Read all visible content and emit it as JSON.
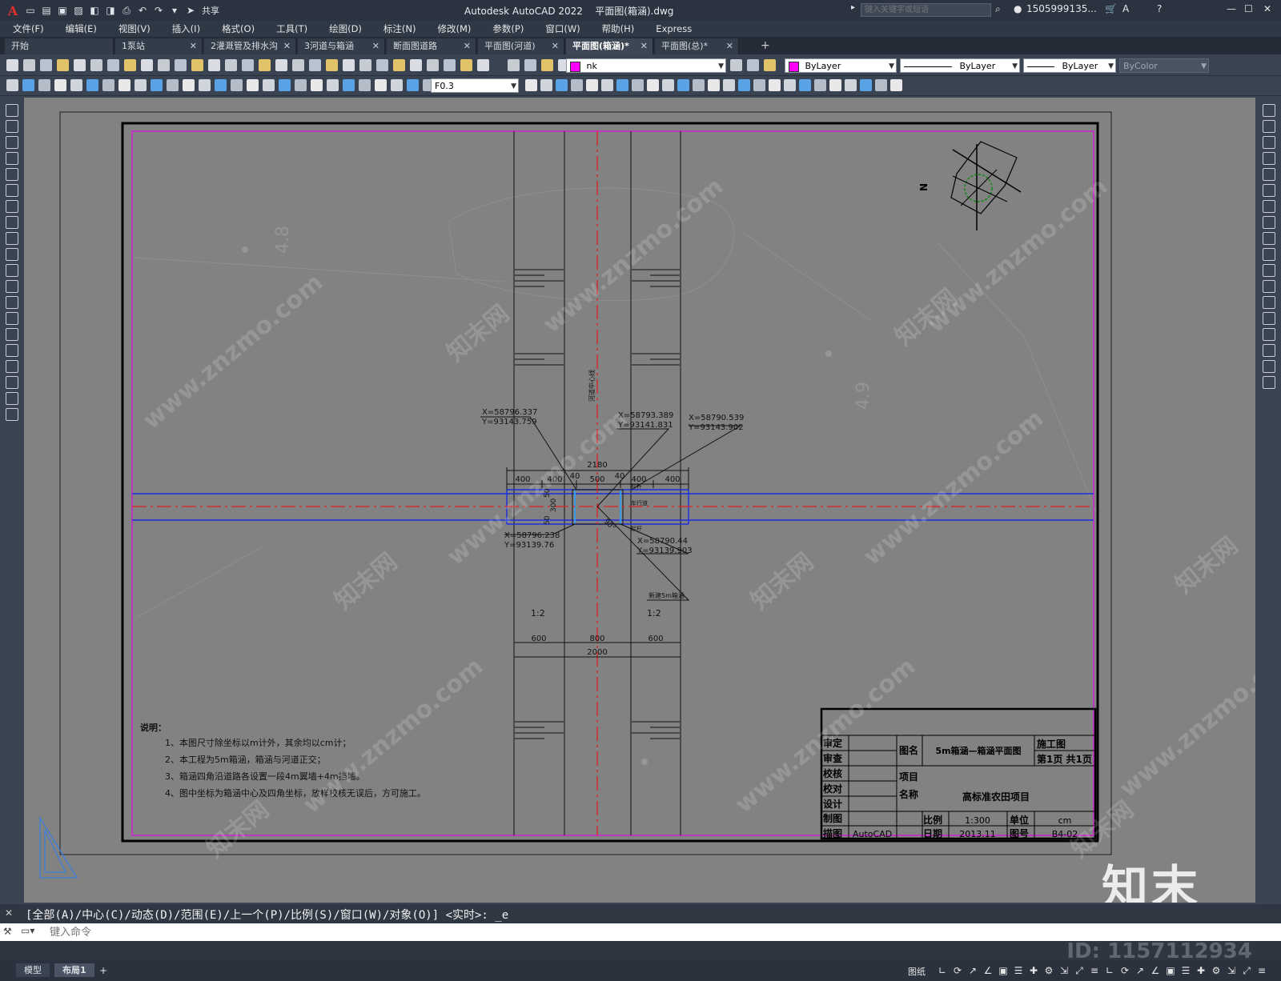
{
  "titlebar": {
    "app_name": "Autodesk AutoCAD 2022",
    "file_name": "平面图(箱涵).dwg",
    "share_label": "共享",
    "search_placeholder": "键入关键字或短语",
    "user": "1505999135...",
    "help": "?"
  },
  "menu": [
    "文件(F)",
    "编辑(E)",
    "视图(V)",
    "插入(I)",
    "格式(O)",
    "工具(T)",
    "绘图(D)",
    "标注(N)",
    "修改(M)",
    "参数(P)",
    "窗口(W)",
    "帮助(H)",
    "Express"
  ],
  "tabs": [
    {
      "label": "开始",
      "closable": false
    },
    {
      "label": "1泵站",
      "closable": true
    },
    {
      "label": "2灌溉管及排水沟",
      "closable": true
    },
    {
      "label": "3河道与箱涵",
      "closable": true
    },
    {
      "label": "断面图道路",
      "closable": true
    },
    {
      "label": "平面图(河道)",
      "closable": true
    },
    {
      "label": "平面图(箱涵)*",
      "closable": true,
      "active": true
    },
    {
      "label": "平面图(总)*",
      "closable": true
    }
  ],
  "toolbar": {
    "layer_value": "nk",
    "color_value": "ByLayer",
    "linetype_value": "ByLayer",
    "lineweight_value": "ByLayer",
    "plotstyle_value": "ByColor",
    "textstyle_value": "F0.3",
    "layer_color": "#ff00ff"
  },
  "drawing": {
    "dims_top": {
      "total": "2180",
      "left": "400",
      "l2": "400",
      "l3": "40",
      "mid": "500",
      "r3": "40",
      "r2": "400",
      "right": "400"
    },
    "dims_side": [
      "50",
      "300",
      "50"
    ],
    "dims_bottom": {
      "left": "600",
      "mid": "800",
      "right": "600",
      "total": "2000"
    },
    "slope_left": "1:2",
    "slope_right": "1:2",
    "angle": "90°",
    "river_label": "河道中心线",
    "road_label": "车行道",
    "rail_top": "栏杆",
    "rail_bottom": "栏杆",
    "culvert_label": "新建5m箱涵",
    "coords": [
      {
        "x": "X=58796.337",
        "y": "Y=93143.759"
      },
      {
        "x": "X=58793.389",
        "y": "Y=93141.831"
      },
      {
        "x": "X=58790.539",
        "y": "Y=93143.902"
      },
      {
        "x": "X=58796.238",
        "y": "Y=93139.76"
      },
      {
        "x": "X=58790.44",
        "y": "Y=93139.903"
      }
    ],
    "notes_title": "说明：",
    "notes": [
      "1、本图尺寸除坐标以m计外，其余均以cm计；",
      "2、本工程为5m箱涵，箱涵与河道正交；",
      "3、箱涵四角沿道路各设置一段4m翼墙+4m挡墙。",
      "4、图中坐标为箱涵中心及四角坐标，放样校核无误后，方可施工。"
    ],
    "north_label": "N",
    "bg_numbers": [
      "4.8",
      "4.9"
    ],
    "title_block": {
      "roles": [
        "审定",
        "审查",
        "校核",
        "校对",
        "设计",
        "制图",
        "描图"
      ],
      "draw_tool": "AutoCAD",
      "name_label": "图名",
      "drawing_name": "5m箱涵—箱涵平面图",
      "stage": "施工图",
      "page": "第1页 共1页",
      "project_label_1": "项目",
      "project_label_2": "名称",
      "project_name": "高标准农田项目",
      "scale_label": "比例",
      "scale": "1:300",
      "unit_label": "单位",
      "unit": "cm",
      "date_label": "日期",
      "date": "2013.11",
      "drawing_no_label": "图号",
      "drawing_no": "B4-02"
    }
  },
  "watermark": {
    "site": "www.znzmo.com",
    "brand": "知末网",
    "corner": "知末",
    "id": "ID: 1157112934"
  },
  "command": {
    "history": "[全部(A)/中心(C)/动态(D)/范围(E)/上一个(P)/比例(S)/窗口(W)/对象(O)] <实时>: _e",
    "placeholder": "键入命令"
  },
  "layout_tabs": [
    {
      "label": "模型"
    },
    {
      "label": "布局1",
      "active": true
    }
  ],
  "status": {
    "paper_label": "图纸"
  }
}
